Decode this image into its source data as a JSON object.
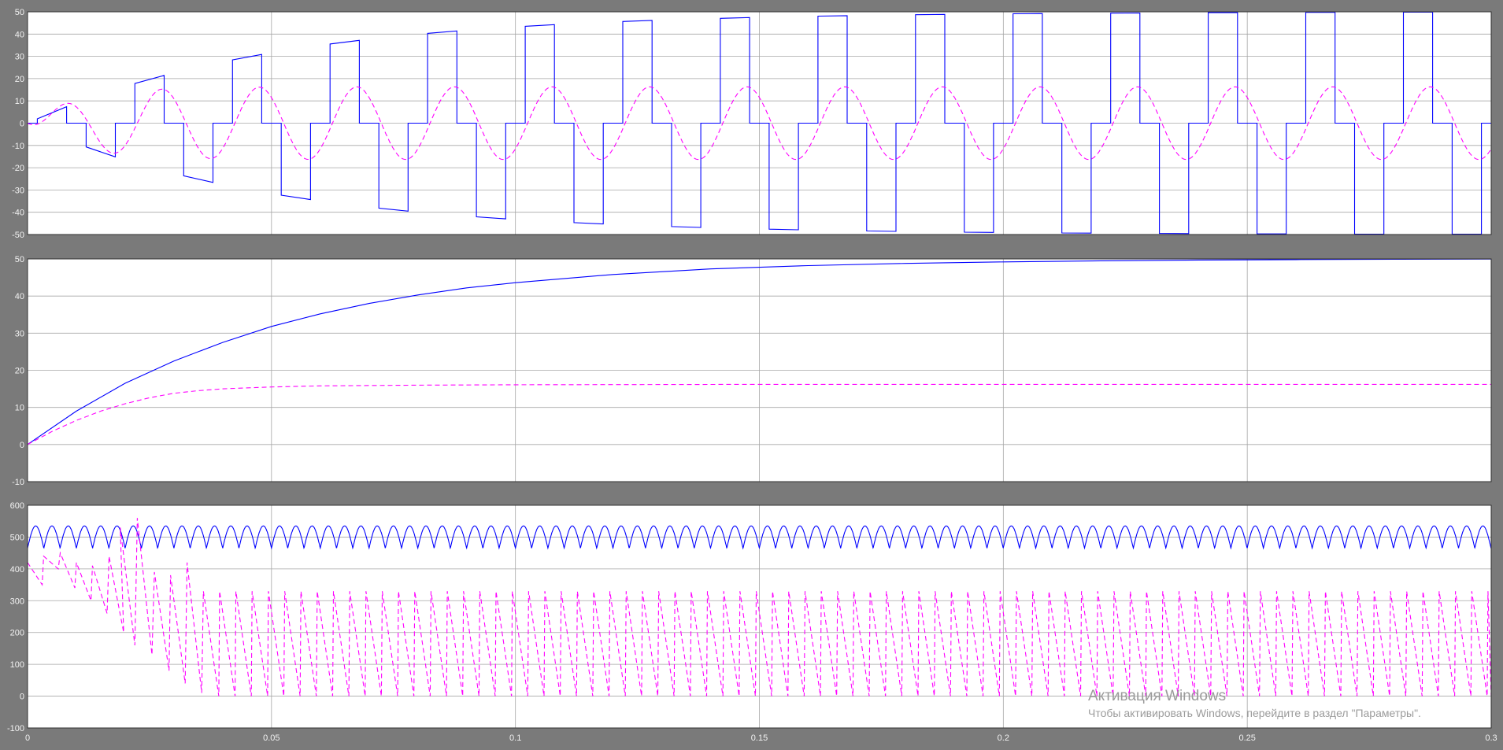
{
  "colors": {
    "figure_bg": "#7a7a7a",
    "axes_bg": "#ffffff",
    "grid": "#a6a6a6",
    "tick_text": "#f2f2f2",
    "series_solid": "#0000ff",
    "series_dashed": "#ff00ff"
  },
  "chart_data": [
    {
      "type": "line",
      "title": "",
      "xlabel": "",
      "ylabel": "",
      "xlim": [
        0,
        0.3
      ],
      "ylim": [
        -50,
        50
      ],
      "grid": true,
      "x_ticks": [
        "0",
        "0.05",
        "0.1",
        "0.15",
        "0.2",
        "0.25",
        "0.3"
      ],
      "y_ticks": [
        "-50",
        "-40",
        "-30",
        "-20",
        "-10",
        "0",
        "10",
        "20",
        "30",
        "40",
        "50"
      ],
      "show_x_tick_labels": false,
      "series": [
        {
          "style": "solid",
          "color": "#0000ff",
          "description_shape": "three-level quasi-square wave, period 0.02, growing envelope",
          "period": 0.02,
          "envelope": {
            "final": 50,
            "tau": 0.05
          },
          "points": [
            [
              0,
              0
            ],
            [
              0.002,
              2
            ],
            [
              0.008,
              7.5
            ],
            [
              0.012,
              -11
            ],
            [
              0.018,
              -15.5
            ],
            [
              0.022,
              18
            ],
            [
              0.028,
              22
            ],
            [
              0.032,
              -24
            ],
            [
              0.038,
              -27
            ],
            [
              0.042,
              28.5
            ],
            [
              0.048,
              31.5
            ],
            [
              0.052,
              -33
            ],
            [
              0.058,
              -35
            ],
            [
              0.062,
              36
            ],
            [
              0.068,
              37.5
            ],
            [
              0.072,
              -38.5
            ],
            [
              0.078,
              -40
            ],
            [
              0.082,
              40.5
            ],
            [
              0.088,
              42
            ],
            [
              0.092,
              -42.5
            ],
            [
              0.098,
              -43.5
            ],
            [
              0.102,
              44
            ],
            [
              0.108,
              45
            ],
            [
              0.112,
              -45
            ],
            [
              0.118,
              -45.8
            ],
            [
              0.122,
              46
            ],
            [
              0.128,
              46.5
            ],
            [
              0.132,
              -46.8
            ],
            [
              0.138,
              -47.2
            ],
            [
              0.142,
              47.5
            ],
            [
              0.148,
              47.8
            ],
            [
              0.152,
              -48
            ],
            [
              0.158,
              -48.3
            ],
            [
              0.162,
              48.3
            ],
            [
              0.168,
              48.6
            ],
            [
              0.172,
              -48.6
            ],
            [
              0.178,
              -48.8
            ],
            [
              0.182,
              48.9
            ],
            [
              0.188,
              49.1
            ],
            [
              0.192,
              -49.1
            ],
            [
              0.198,
              -49.3
            ],
            [
              0.202,
              49.3
            ],
            [
              0.208,
              49.4
            ],
            [
              0.212,
              -49.4
            ],
            [
              0.218,
              -49.5
            ],
            [
              0.222,
              49.5
            ],
            [
              0.228,
              49.6
            ],
            [
              0.232,
              -49.6
            ],
            [
              0.238,
              -49.7
            ],
            [
              0.242,
              49.7
            ],
            [
              0.248,
              49.7
            ],
            [
              0.252,
              -49.7
            ],
            [
              0.258,
              -49.8
            ],
            [
              0.262,
              49.8
            ],
            [
              0.268,
              49.8
            ],
            [
              0.272,
              -49.8
            ],
            [
              0.278,
              -49.8
            ],
            [
              0.282,
              49.8
            ],
            [
              0.288,
              49.9
            ],
            [
              0.292,
              -49.9
            ],
            [
              0.298,
              -49.9
            ]
          ]
        },
        {
          "style": "dashed",
          "color": "#ff00ff",
          "description_shape": "sinusoid, period 0.02, amplitude rising to about 16",
          "period": 0.02,
          "envelope": {
            "final": 16.3,
            "tau": 0.01
          },
          "amplitude_samples": [
            [
              0.005,
              6
            ],
            [
              0.015,
              -11
            ],
            [
              0.025,
              13.5
            ],
            [
              0.035,
              -15
            ],
            [
              0.045,
              15.5
            ],
            [
              0.055,
              -16
            ],
            [
              0.065,
              16.2
            ],
            [
              0.3,
              16.3
            ]
          ]
        }
      ]
    },
    {
      "type": "line",
      "title": "",
      "xlabel": "",
      "ylabel": "",
      "xlim": [
        0,
        0.3
      ],
      "ylim": [
        -10,
        50
      ],
      "grid": true,
      "x_ticks": [
        "0",
        "0.05",
        "0.1",
        "0.15",
        "0.2",
        "0.25",
        "0.3"
      ],
      "y_ticks": [
        "-10",
        "0",
        "10",
        "20",
        "30",
        "40",
        "50"
      ],
      "show_x_tick_labels": false,
      "series": [
        {
          "style": "solid",
          "color": "#0000ff",
          "points": [
            [
              0,
              0
            ],
            [
              0.01,
              9
            ],
            [
              0.02,
              16.5
            ],
            [
              0.03,
              22.5
            ],
            [
              0.04,
              27.5
            ],
            [
              0.05,
              31.8
            ],
            [
              0.06,
              35.2
            ],
            [
              0.07,
              38
            ],
            [
              0.08,
              40.3
            ],
            [
              0.09,
              42.2
            ],
            [
              0.1,
              43.6
            ],
            [
              0.12,
              45.8
            ],
            [
              0.14,
              47.3
            ],
            [
              0.16,
              48.2
            ],
            [
              0.18,
              48.8
            ],
            [
              0.2,
              49.2
            ],
            [
              0.22,
              49.5
            ],
            [
              0.24,
              49.7
            ],
            [
              0.26,
              49.8
            ],
            [
              0.28,
              49.9
            ],
            [
              0.3,
              49.95
            ]
          ]
        },
        {
          "style": "dashed",
          "color": "#ff00ff",
          "points": [
            [
              0,
              0
            ],
            [
              0.005,
              3.5
            ],
            [
              0.01,
              6.5
            ],
            [
              0.015,
              9
            ],
            [
              0.02,
              11
            ],
            [
              0.025,
              12.6
            ],
            [
              0.03,
              13.8
            ],
            [
              0.035,
              14.5
            ],
            [
              0.04,
              15
            ],
            [
              0.05,
              15.5
            ],
            [
              0.06,
              15.8
            ],
            [
              0.08,
              16
            ],
            [
              0.1,
              16.1
            ],
            [
              0.15,
              16.2
            ],
            [
              0.2,
              16.2
            ],
            [
              0.25,
              16.2
            ],
            [
              0.3,
              16.2
            ]
          ]
        }
      ]
    },
    {
      "type": "line",
      "title": "",
      "xlabel": "",
      "ylabel": "",
      "xlim": [
        0,
        0.3
      ],
      "ylim": [
        -100,
        600
      ],
      "grid": true,
      "x_ticks": [
        "0",
        "0.05",
        "0.1",
        "0.15",
        "0.2",
        "0.25",
        "0.3"
      ],
      "y_ticks": [
        "-100",
        "0",
        "100",
        "200",
        "300",
        "400",
        "500",
        "600"
      ],
      "show_x_tick_labels": true,
      "series": [
        {
          "style": "solid",
          "color": "#0000ff",
          "description_shape": "rectified ripple between about 465 and 535, period 0.00333",
          "ripple": {
            "min": 465,
            "max": 535,
            "period": 0.003333
          }
        },
        {
          "style": "dashed",
          "color": "#ff00ff",
          "description_shape": "sawtooth, period 0.00333, decaying peaks settling 0..330",
          "sawtooth": {
            "period": 0.003333,
            "settled_max": 330,
            "settled_min": 0
          },
          "early_cycles": [
            [
              0.0,
              420,
              350
            ],
            [
              0.0033,
              440,
              400
            ],
            [
              0.0067,
              450,
              340
            ],
            [
              0.01,
              420,
              300
            ],
            [
              0.0133,
              410,
              260
            ],
            [
              0.0167,
              440,
              200
            ],
            [
              0.019,
              530,
              160
            ],
            [
              0.0225,
              560,
              130
            ],
            [
              0.026,
              390,
              80
            ],
            [
              0.0293,
              380,
              40
            ],
            [
              0.0327,
              420,
              10
            ]
          ]
        }
      ]
    }
  ],
  "watermark": {
    "title": "Активация Windows",
    "subtitle": "Чтобы активировать Windows, перейдите в раздел \"Параметры\"."
  }
}
